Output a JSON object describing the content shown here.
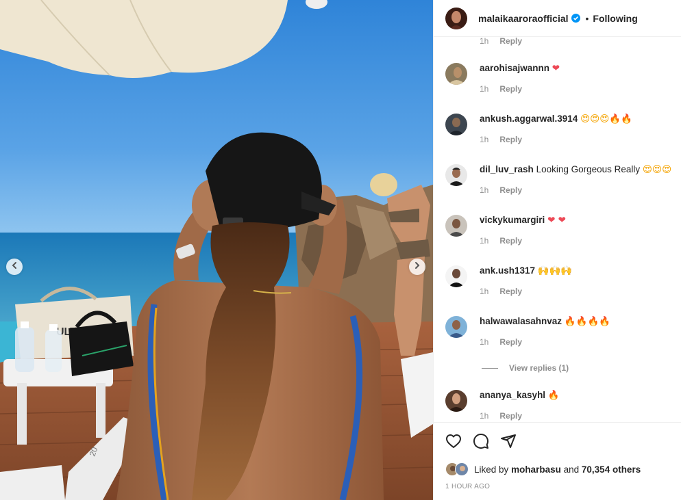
{
  "post": {
    "username": "malaikaaroraofficial",
    "follow_status": "Following",
    "separator": "•"
  },
  "photo": {
    "stand_label": "ULTU",
    "lounger_number": "20"
  },
  "comments": {
    "first_meta": {
      "time": "1h",
      "reply": "Reply"
    },
    "items": [
      {
        "username": "aarohisajwannn",
        "text": "",
        "emoji": "❤",
        "emoji_color": "#ed4956",
        "time": "1h",
        "reply": "Reply"
      },
      {
        "username": "ankush.aggarwal.3914",
        "text": "",
        "emoji": "😍😍😍🔥🔥",
        "emoji_color": "#f4a300",
        "time": "1h",
        "reply": "Reply"
      },
      {
        "username": "dil_luv_rash",
        "text": "Looking Gorgeous Really",
        "emoji": "😍😍😍",
        "emoji_color": "#f4a300",
        "time": "1h",
        "reply": "Reply"
      },
      {
        "username": "vickykumargiri",
        "text": "",
        "emoji": "❤ ❤",
        "emoji_color": "#ed4956",
        "time": "1h",
        "reply": "Reply"
      },
      {
        "username": "ank.ush1317",
        "text": "",
        "emoji": "🙌🙌🙌",
        "emoji_color": "#f4c400",
        "time": "1h",
        "reply": "Reply"
      },
      {
        "username": "halwawalasahnvaz",
        "text": "",
        "emoji": "🔥🔥🔥🔥",
        "emoji_color": "#f27a1a",
        "time": "1h",
        "reply": "Reply"
      },
      {
        "username": "ananya_kasyhl",
        "text": "",
        "emoji": "🔥",
        "emoji_color": "#f27a1a",
        "time": "1h",
        "reply": "Reply"
      }
    ],
    "view_replies": "View replies (1)"
  },
  "likes": {
    "prefix": "Liked by",
    "user": "moharbasu",
    "middle": "and",
    "count": "70,354 others"
  },
  "timestamp": "1 HOUR AGO",
  "icons": [
    "heart-icon",
    "comment-icon",
    "share-icon",
    "verified-badge-icon",
    "chevron-left-icon",
    "chevron-right-icon"
  ],
  "colors": {
    "verified": "#0095f6",
    "muted": "#8e8e8e",
    "text": "#262626",
    "border": "#efefef"
  }
}
